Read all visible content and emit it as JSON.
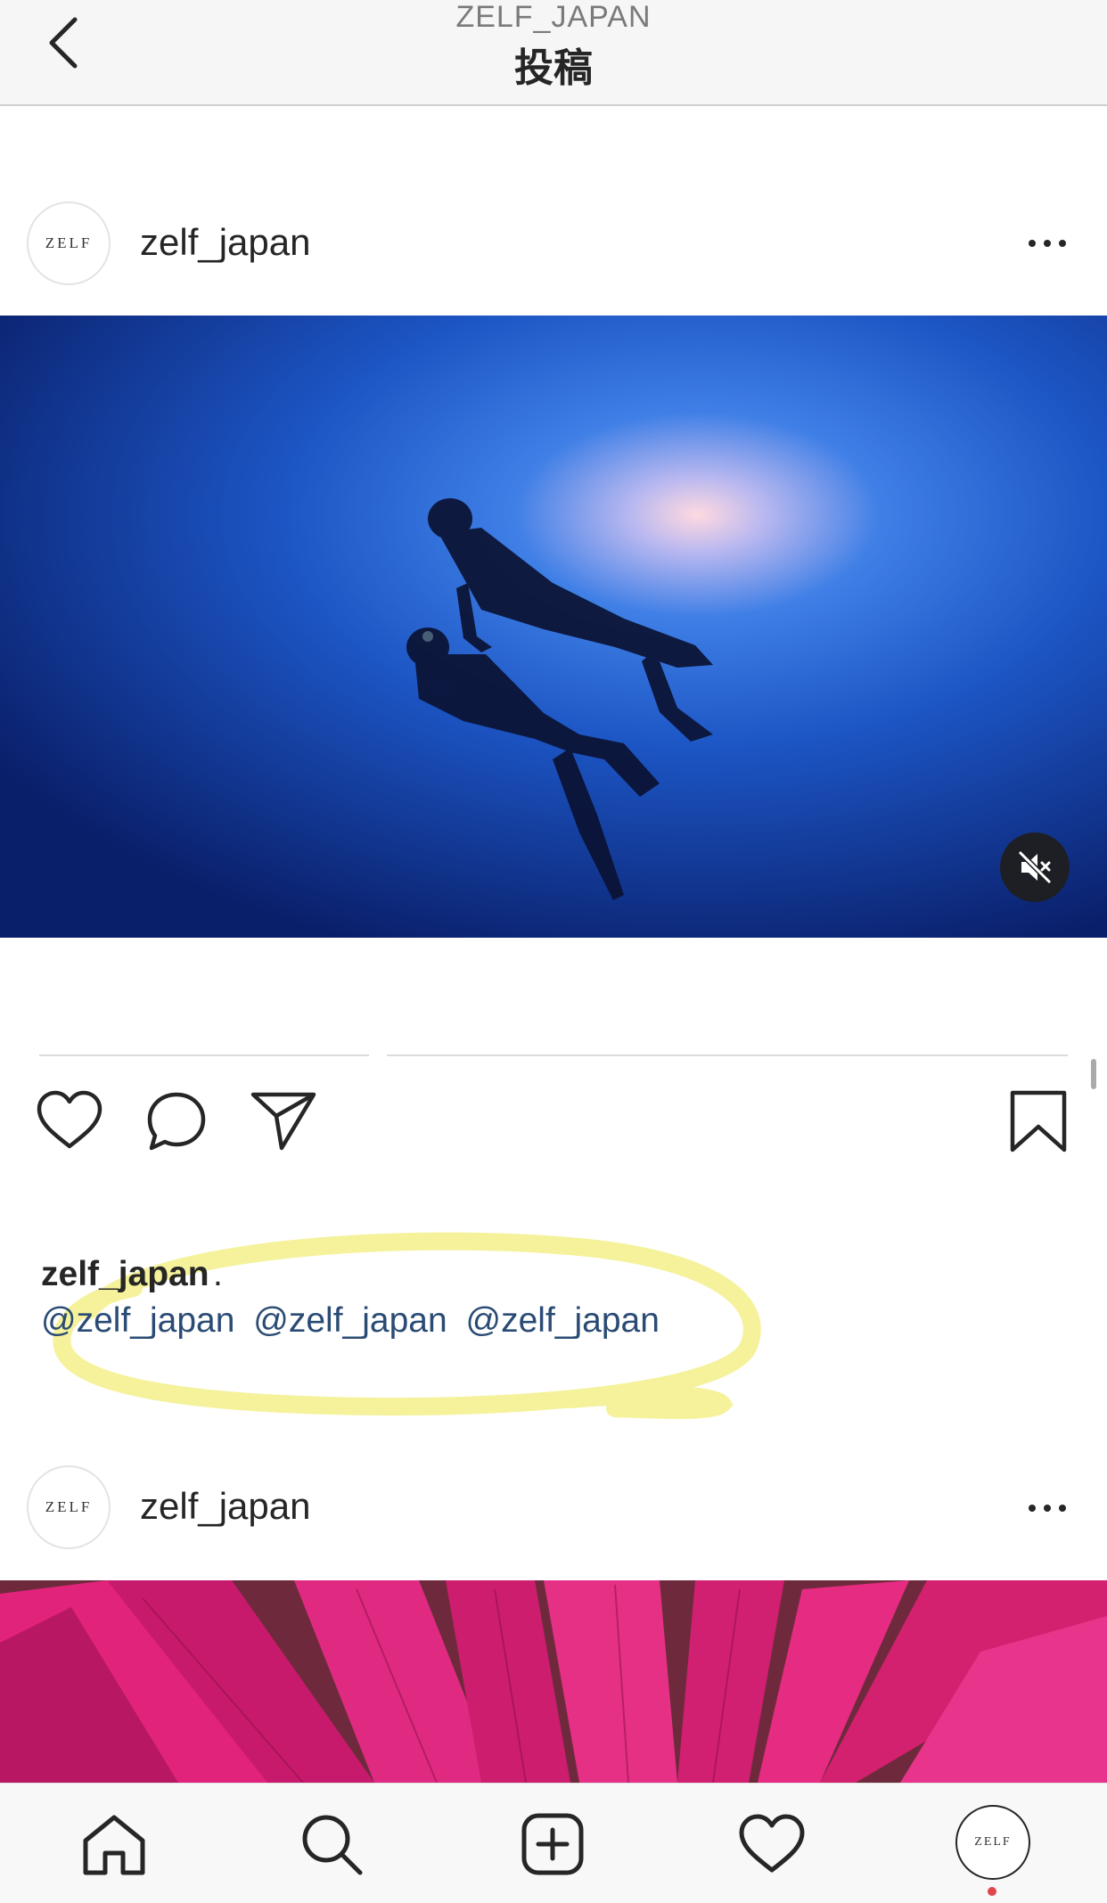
{
  "header": {
    "account": "ZELF_JAPAN",
    "title": "投稿",
    "back_icon": "chevron-left-icon"
  },
  "posts": [
    {
      "avatar_text": "ZELF",
      "username": "zelf_japan",
      "media_type": "video",
      "media_description_icon": "muted-speaker-icon",
      "actions": [
        "heart-icon",
        "comment-icon",
        "send-icon",
        "bookmark-icon"
      ],
      "caption": {
        "username": "zelf_japan",
        "text": ".",
        "mentions": [
          "@zelf_japan",
          "@zelf_japan",
          "@zelf_japan"
        ]
      }
    },
    {
      "avatar_text": "ZELF",
      "username": "zelf_japan",
      "media_type": "image"
    }
  ],
  "tabbar": {
    "items": [
      "home-icon",
      "search-icon",
      "new-post-icon",
      "activity-icon",
      "profile-avatar"
    ],
    "profile_avatar_text": "ZELF"
  },
  "colors": {
    "mention": "#2a4b74",
    "highlight": "#f3f08a",
    "notification": "#e0464f"
  }
}
